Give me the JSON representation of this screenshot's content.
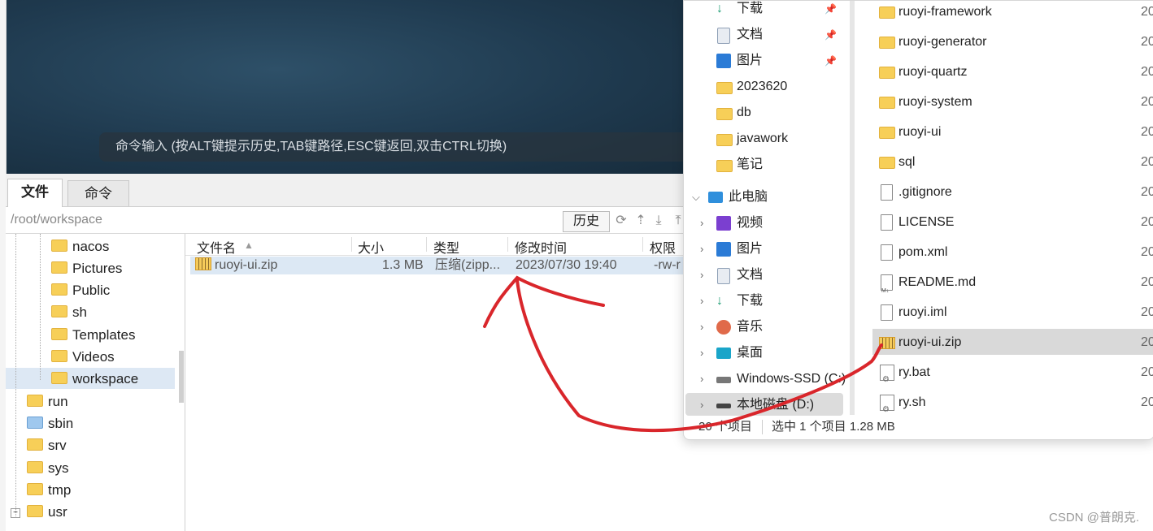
{
  "terminal": {
    "command_hint": "命令输入 (按ALT键提示历史,TAB键路径,ESC键返回,双击CTRL切换)"
  },
  "tabs": [
    {
      "label": "文件"
    },
    {
      "label": "命令"
    }
  ],
  "pathbar": {
    "path": "/root/workspace",
    "history_label": "历史"
  },
  "tree": {
    "items": [
      {
        "label": "nacos"
      },
      {
        "label": "Pictures"
      },
      {
        "label": "Public"
      },
      {
        "label": "sh"
      },
      {
        "label": "Templates"
      },
      {
        "label": "Videos"
      },
      {
        "label": "workspace"
      },
      {
        "label": "run"
      },
      {
        "label": "sbin"
      },
      {
        "label": "srv"
      },
      {
        "label": "sys"
      },
      {
        "label": "tmp"
      },
      {
        "label": "usr"
      }
    ]
  },
  "filelist": {
    "headers": {
      "name": "文件名",
      "size": "大小",
      "type": "类型",
      "mtime": "修改时间",
      "perm": "权限"
    },
    "rows": [
      {
        "name": "ruoyi-ui.zip",
        "size": "1.3 MB",
        "type": "压缩(zipp...",
        "mtime": "2023/07/30 19:40",
        "perm": "-rw-r"
      }
    ]
  },
  "explorer": {
    "nav": [
      {
        "label": "下载",
        "icon": "download-icon",
        "pinned": true
      },
      {
        "label": "文档",
        "icon": "document-icon",
        "pinned": true
      },
      {
        "label": "图片",
        "icon": "picture-icon",
        "pinned": true
      },
      {
        "label": "2023620",
        "icon": "folder-icon"
      },
      {
        "label": "db",
        "icon": "folder-icon"
      },
      {
        "label": "javawork",
        "icon": "folder-icon"
      },
      {
        "label": "笔记",
        "icon": "folder-icon"
      },
      {
        "label": "此电脑",
        "icon": "computer-icon"
      },
      {
        "label": "视频",
        "icon": "video-icon"
      },
      {
        "label": "图片",
        "icon": "picture-icon"
      },
      {
        "label": "文档",
        "icon": "document-icon"
      },
      {
        "label": "下载",
        "icon": "download-icon"
      },
      {
        "label": "音乐",
        "icon": "music-icon"
      },
      {
        "label": "桌面",
        "icon": "desktop-icon"
      },
      {
        "label": "Windows-SSD (C:)",
        "icon": "drive-icon"
      },
      {
        "label": "本地磁盘 (D:)",
        "icon": "drive-icon"
      }
    ],
    "items": [
      {
        "name": "ruoyi-framework",
        "kind": "folder",
        "date": "20"
      },
      {
        "name": "ruoyi-generator",
        "kind": "folder",
        "date": "20"
      },
      {
        "name": "ruoyi-quartz",
        "kind": "folder",
        "date": "20"
      },
      {
        "name": "ruoyi-system",
        "kind": "folder",
        "date": "20"
      },
      {
        "name": "ruoyi-ui",
        "kind": "folder",
        "date": "20"
      },
      {
        "name": "sql",
        "kind": "folder",
        "date": "20"
      },
      {
        "name": ".gitignore",
        "kind": "file",
        "date": "20"
      },
      {
        "name": "LICENSE",
        "kind": "file",
        "date": "20"
      },
      {
        "name": "pom.xml",
        "kind": "file",
        "date": "20"
      },
      {
        "name": "README.md",
        "kind": "md",
        "date": "20"
      },
      {
        "name": "ruoyi.iml",
        "kind": "file",
        "date": "20"
      },
      {
        "name": "ruoyi-ui.zip",
        "kind": "zip",
        "date": "20"
      },
      {
        "name": "ry.bat",
        "kind": "script",
        "date": "20"
      },
      {
        "name": "ry.sh",
        "kind": "script",
        "date": "20"
      }
    ],
    "status": {
      "count": "20 个项目",
      "selected": "选中 1 个项目 1.28 MB"
    }
  },
  "watermark": "CSDN @普朗克."
}
